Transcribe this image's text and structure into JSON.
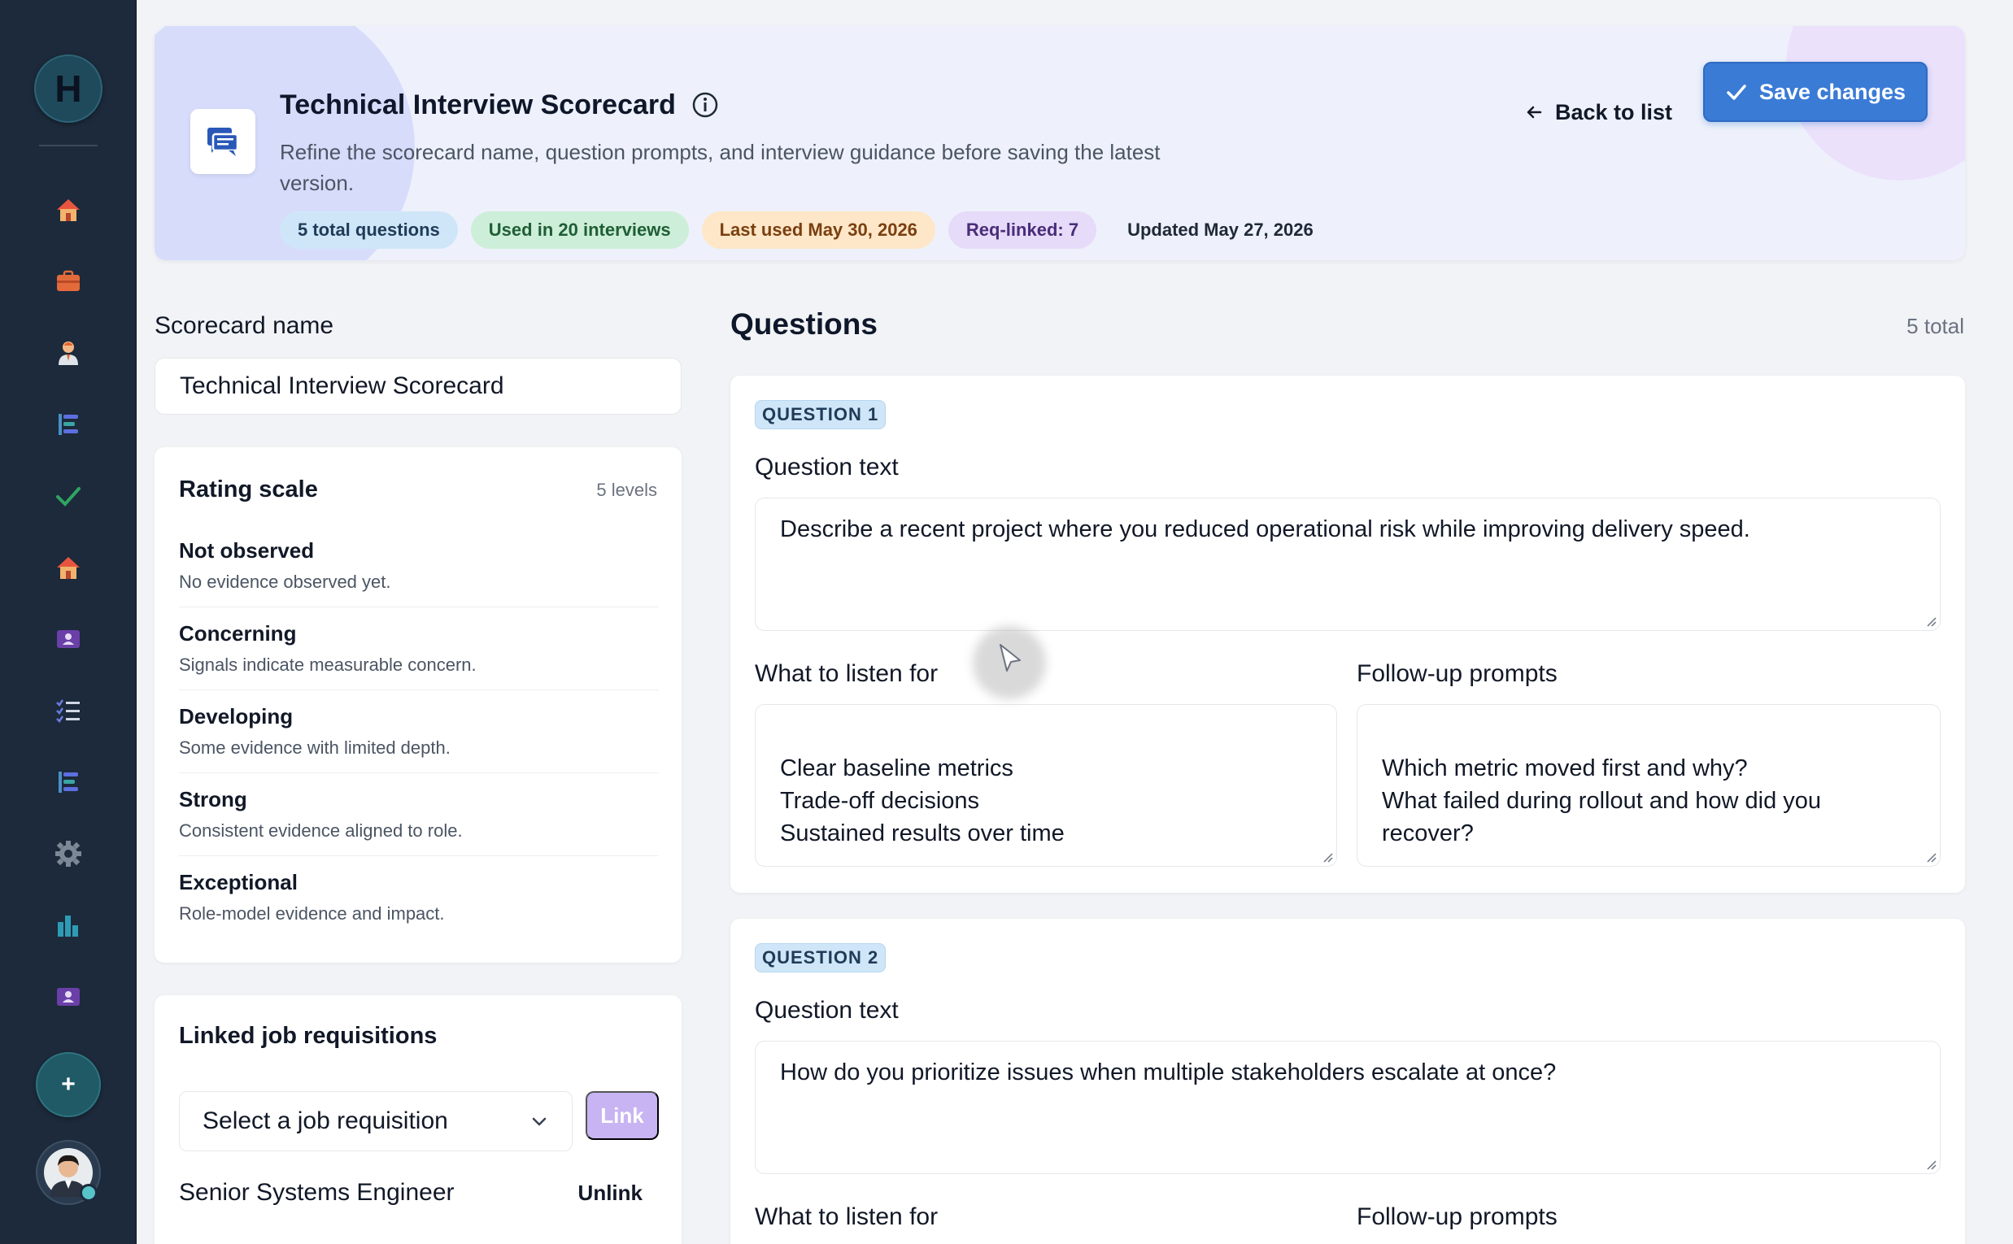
{
  "sidebar": {
    "brand_letter": "H",
    "icons": [
      "home-icon",
      "briefcase-icon",
      "person-icon",
      "tree-list-icon",
      "check-icon",
      "home-icon",
      "id-card-icon",
      "checklist-icon",
      "tree-list-icon",
      "gear-icon",
      "bar-chart-icon",
      "id-card-icon"
    ],
    "add_label": "+"
  },
  "header": {
    "title": "Technical Interview Scorecard",
    "description": "Refine the scorecard name, question prompts, and interview guidance before saving the latest version.",
    "chips": {
      "questions": "5 total questions",
      "used": "Used in 20 interviews",
      "last_used": "Last used May 30, 2026",
      "req_linked": "Req-linked: 7",
      "updated": "Updated May 27, 2026"
    },
    "back_label": "Back to list",
    "save_label": "Save changes"
  },
  "scorecard": {
    "name_label": "Scorecard name",
    "name_value": "Technical Interview Scorecard"
  },
  "rating_scale": {
    "title": "Rating scale",
    "meta": "5 levels",
    "levels": [
      {
        "name": "Not observed",
        "desc": "No evidence observed yet."
      },
      {
        "name": "Concerning",
        "desc": "Signals indicate measurable concern."
      },
      {
        "name": "Developing",
        "desc": "Some evidence with limited depth."
      },
      {
        "name": "Strong",
        "desc": "Consistent evidence aligned to role."
      },
      {
        "name": "Exceptional",
        "desc": "Role-model evidence and impact."
      }
    ]
  },
  "linked": {
    "title": "Linked job requisitions",
    "select_placeholder": "Select a job requisition",
    "link_label": "Link",
    "requisitions": [
      {
        "name": "Senior Systems Engineer",
        "action": "Unlink"
      }
    ]
  },
  "questions": {
    "heading": "Questions",
    "total": "5 total",
    "items": [
      {
        "badge": "QUESTION 1",
        "text_label": "Question text",
        "text": "Describe a recent project where you reduced operational risk while improving delivery speed.",
        "listen_label": "What to listen for",
        "listen": "Clear baseline metrics\nTrade-off decisions\nSustained results over time",
        "followup_label": "Follow-up prompts",
        "followup": "Which metric moved first and why?\nWhat failed during rollout and how did you recover?"
      },
      {
        "badge": "QUESTION 2",
        "text_label": "Question text",
        "text": "How do you prioritize issues when multiple stakeholders escalate at once?",
        "listen_label": "What to listen for",
        "followup_label": "Follow-up prompts"
      }
    ]
  },
  "colors": {
    "sidebar_bg": "#1c2a3b",
    "accent": "#3a7bd5",
    "link_disabled": "#c8b4f2"
  }
}
